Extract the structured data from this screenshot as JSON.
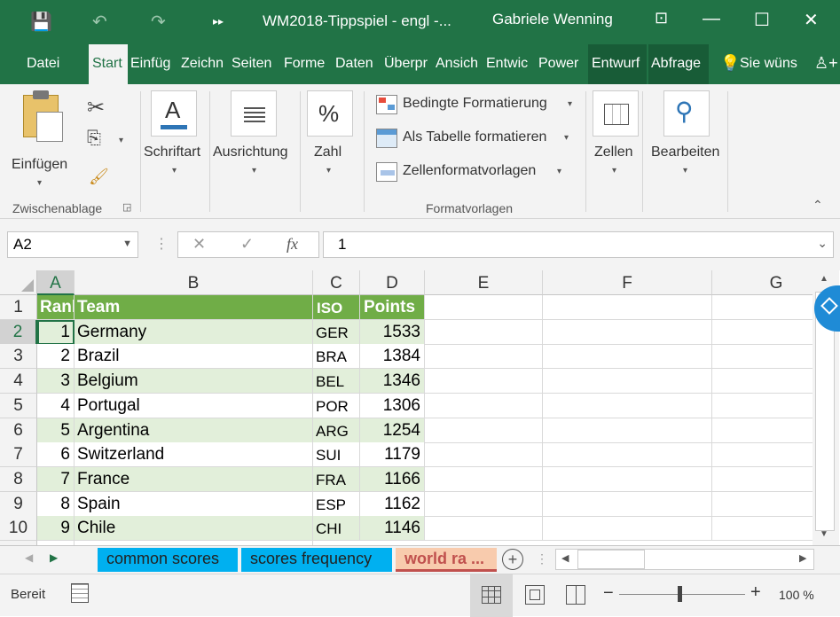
{
  "titlebar": {
    "title": "WM2018-Tippspiel - engl  -...",
    "user": "Gabriele Wenning",
    "save_icon": "💾",
    "undo_icon": "↶",
    "redo_icon": "↷",
    "customize_icon": "▸▸",
    "restore_icon": "⊡",
    "minimize_icon": "—",
    "maximize_icon": "☐",
    "close_icon": "✕"
  },
  "tabs": [
    "Datei",
    "Start",
    "Einfüg",
    "Zeichn",
    "Seiten",
    "Forme",
    "Daten",
    "Überpr",
    "Ansich",
    "Entwic",
    "Power",
    "Entwurf",
    "Abfrage"
  ],
  "tell_me": "Sie wüns",
  "share_icon": "♙+",
  "ribbon": {
    "paste": "Einfügen",
    "clipboard_group": "Zwischenablage",
    "font": "Schriftart",
    "alignment": "Ausrichtung",
    "number": "Zahl",
    "conditional": "Bedingte Formatierung",
    "as_table": "Als Tabelle formatieren",
    "cell_styles": "Zellenformatvorlagen",
    "styles_group": "Formatvorlagen",
    "cells": "Zellen",
    "editing": "Bearbeiten",
    "font_icon": "A",
    "number_icon": "%",
    "editing_icon": "⚲"
  },
  "formula": {
    "namebox": "A2",
    "cancel": "✕",
    "enter": "✓",
    "fx": "fx",
    "value": "1"
  },
  "columns": [
    "A",
    "B",
    "C",
    "D",
    "E",
    "F",
    "G"
  ],
  "header_row": {
    "rank": "Rank",
    "team": "Team",
    "iso": "ISO",
    "points": "Points"
  },
  "rows": [
    {
      "n": "2",
      "rank": "1",
      "team": "Germany",
      "iso": "GER",
      "points": "1533"
    },
    {
      "n": "3",
      "rank": "2",
      "team": "Brazil",
      "iso": "BRA",
      "points": "1384"
    },
    {
      "n": "4",
      "rank": "3",
      "team": "Belgium",
      "iso": "BEL",
      "points": "1346"
    },
    {
      "n": "5",
      "rank": "4",
      "team": "Portugal",
      "iso": "POR",
      "points": "1306"
    },
    {
      "n": "6",
      "rank": "5",
      "team": "Argentina",
      "iso": "ARG",
      "points": "1254"
    },
    {
      "n": "7",
      "rank": "6",
      "team": "Switzerland",
      "iso": "SUI",
      "points": "1179"
    },
    {
      "n": "8",
      "rank": "7",
      "team": "France",
      "iso": "FRA",
      "points": "1166"
    },
    {
      "n": "9",
      "rank": "8",
      "team": "Spain",
      "iso": "ESP",
      "points": "1162"
    },
    {
      "n": "10",
      "rank": "9",
      "team": "Chile",
      "iso": "CHI",
      "points": "1146"
    }
  ],
  "sheets": [
    "common scores",
    "scores frequency",
    "world ra ..."
  ],
  "add_sheet": "+",
  "status": {
    "ready": "Bereit",
    "zoom": "100 %",
    "zoom_level": 1.0,
    "minus": "−",
    "plus": "+"
  },
  "colors": {
    "excel_green": "#217346",
    "header_green": "#70ad47",
    "band_green": "#e2efda",
    "tab_blue": "#00b0f0",
    "tab_active": "#f4b084"
  }
}
